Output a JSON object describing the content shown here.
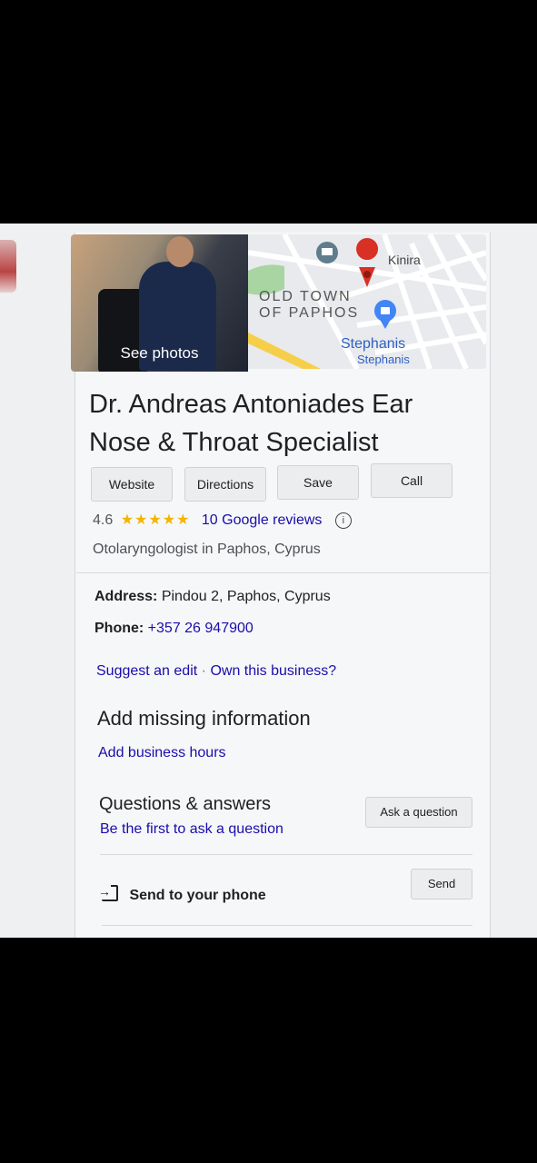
{
  "photo": {
    "label": "See photos"
  },
  "map": {
    "labels": {
      "kinira": "Kinira",
      "old_town_line1": "OLD TOWN",
      "old_town_line2": "OF PAPHOS",
      "stephanis": "Stephanis",
      "stephanis_sub": "Stephanis"
    }
  },
  "business": {
    "name": "Dr. Andreas Antoniades Ear Nose & Throat Specialist",
    "rating": "4.6",
    "stars": "★★★★★",
    "reviews": "10 Google reviews",
    "category": "Otolaryngologist in Paphos, Cyprus"
  },
  "actions": {
    "website": "Website",
    "directions": "Directions",
    "save": "Save",
    "call": "Call"
  },
  "details": {
    "address_label": "Address:",
    "address_value": "Pindou 2, Paphos, Cyprus",
    "phone_label": "Phone:",
    "phone_value": "+357 26 947900"
  },
  "edit_links": {
    "suggest": "Suggest an edit",
    "separator": "·",
    "own": "Own this business?"
  },
  "missing_info": {
    "title": "Add missing information",
    "link": "Add business hours"
  },
  "qa": {
    "title": "Questions & answers",
    "subtitle": "Be the first to ask a question",
    "ask_button": "Ask a question"
  },
  "send": {
    "label": "Send to your phone",
    "button": "Send"
  },
  "colors": {
    "star": "#f4b400",
    "link": "#1a0dab",
    "map_pin": "#d93025",
    "store_pin": "#4285f4"
  }
}
